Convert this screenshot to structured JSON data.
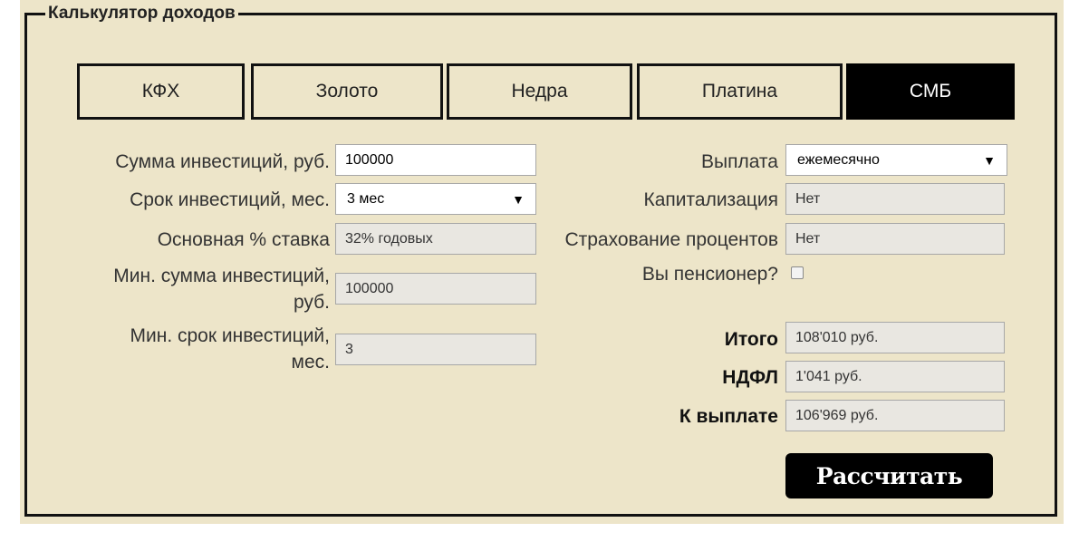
{
  "legend": "Калькулятор доходов",
  "tabs": [
    {
      "label": "КФХ",
      "active": false
    },
    {
      "label": "Золото",
      "active": false
    },
    {
      "label": "Недра",
      "active": false
    },
    {
      "label": "Платина",
      "active": false
    },
    {
      "label": "СМБ",
      "active": true
    }
  ],
  "left": {
    "sum_label": "Сумма инвестиций, руб.",
    "sum_value": "100000",
    "term_label": "Срок инвестиций, мес.",
    "term_value": "3 мес",
    "rate_label": "Основная % ставка",
    "rate_value": "32% годовых",
    "min_sum_label_1": "Мин. сумма инвестиций,",
    "min_sum_label_2": "руб.",
    "min_sum_value": "100000",
    "min_term_label_1": "Мин. срок инвестиций,",
    "min_term_label_2": "мес.",
    "min_term_value": "3"
  },
  "right": {
    "payout_label": "Выплата",
    "payout_value": "ежемесячно",
    "cap_label": "Капитализация",
    "cap_value": "Нет",
    "insurance_label": "Страхование процентов",
    "insurance_value": "Нет",
    "pensioner_label": "Вы пенсионер?",
    "total_label": "Итого",
    "total_value": "108'010 руб.",
    "tax_label": "НДФЛ",
    "tax_value": "1'041 руб.",
    "payable_label": "К выплате",
    "payable_value": "106'969 руб."
  },
  "calculate_label": "Рассчитать"
}
